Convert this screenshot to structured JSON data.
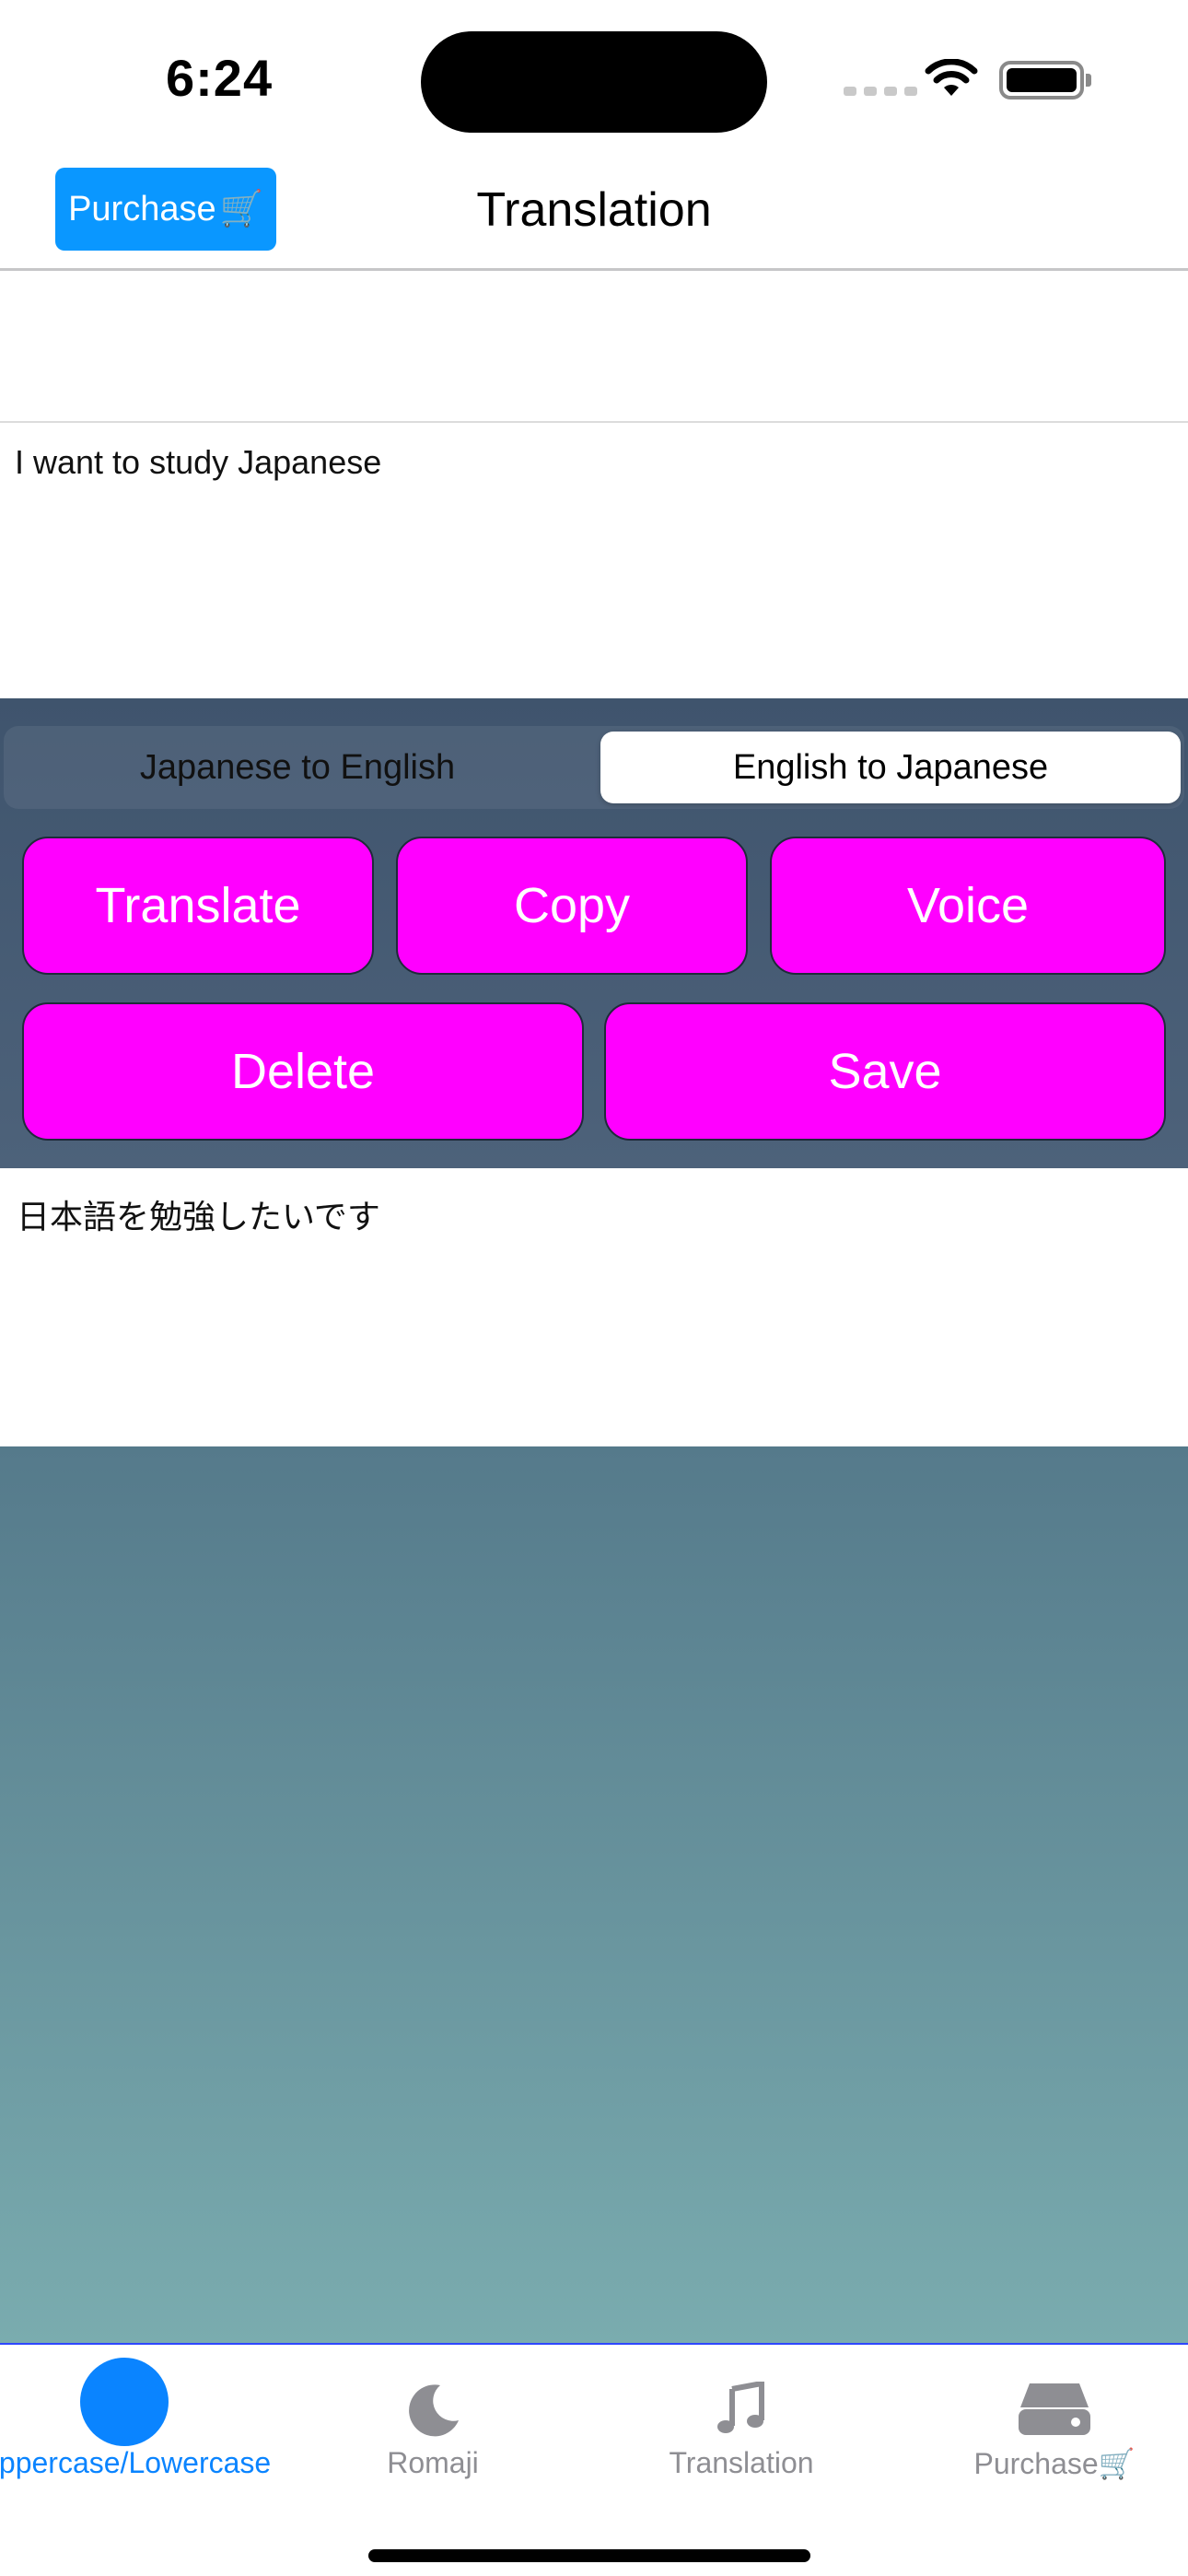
{
  "status_bar": {
    "time": "6:24"
  },
  "nav": {
    "purchase_label": "Purchase",
    "purchase_emoji": "🛒",
    "title": "Translation"
  },
  "input": {
    "text": "I want to study Japanese"
  },
  "segmented": {
    "options": [
      "Japanese to English",
      "English to Japanese"
    ],
    "selected": "English to Japanese"
  },
  "buttons": {
    "translate": "Translate",
    "copy": "Copy",
    "voice": "Voice",
    "delete": "Delete",
    "save": "Save"
  },
  "output": {
    "text": "日本語を勉強したいです"
  },
  "tab_bar": {
    "tabs": [
      {
        "label": "Uppercase/Lowercase",
        "icon": "circle-icon",
        "active": true
      },
      {
        "label": "Romaji",
        "icon": "moon-icon",
        "active": false
      },
      {
        "label": "Translation",
        "icon": "music-note-icon",
        "active": false
      },
      {
        "label": "Purchase🛒",
        "icon": "drive-icon",
        "active": false
      }
    ]
  },
  "colors": {
    "accent": "#0a84ff",
    "button": "#ff00ff",
    "purchase_button": "#0a97ff"
  }
}
